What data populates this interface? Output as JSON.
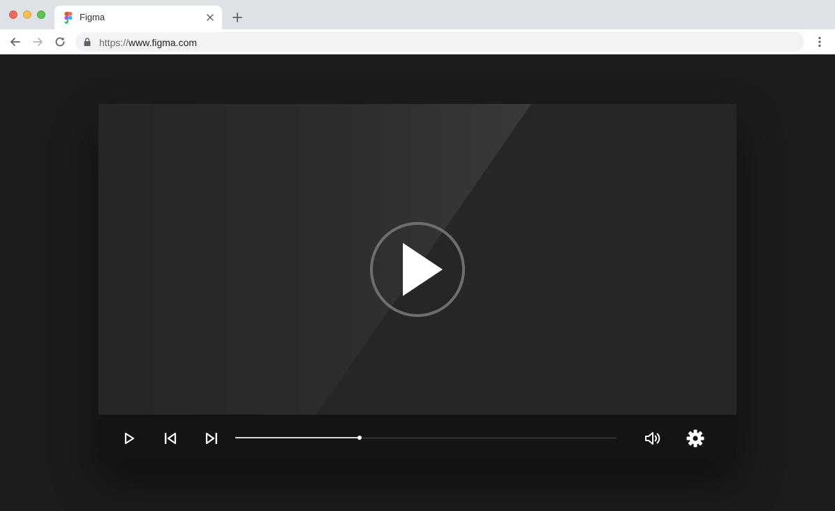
{
  "browser": {
    "tab_title": "Figma",
    "url_scheme": "https://",
    "url_host": "www.figma.com",
    "icons": {
      "close_window": "red-traffic-light",
      "minimize_window": "yellow-traffic-light",
      "maximize_window": "green-traffic-light",
      "tab_favicon": "figma-logo-icon",
      "tab_close": "close-icon",
      "new_tab": "plus-icon",
      "back": "arrow-left-icon",
      "forward": "arrow-right-icon",
      "reload": "reload-icon",
      "secure": "lock-icon",
      "menu": "kebab-menu-icon"
    }
  },
  "player": {
    "icons": {
      "center_play": "play-circle-icon",
      "play": "play-icon",
      "previous": "skip-previous-icon",
      "next": "skip-next-icon",
      "volume": "volume-icon",
      "settings": "gear-icon"
    },
    "progress_fraction": 0.326,
    "colors": {
      "page_background": "#1c1c1c",
      "screen": "#262626",
      "controls_bar": "#141414",
      "accent": "#ffffff"
    }
  }
}
